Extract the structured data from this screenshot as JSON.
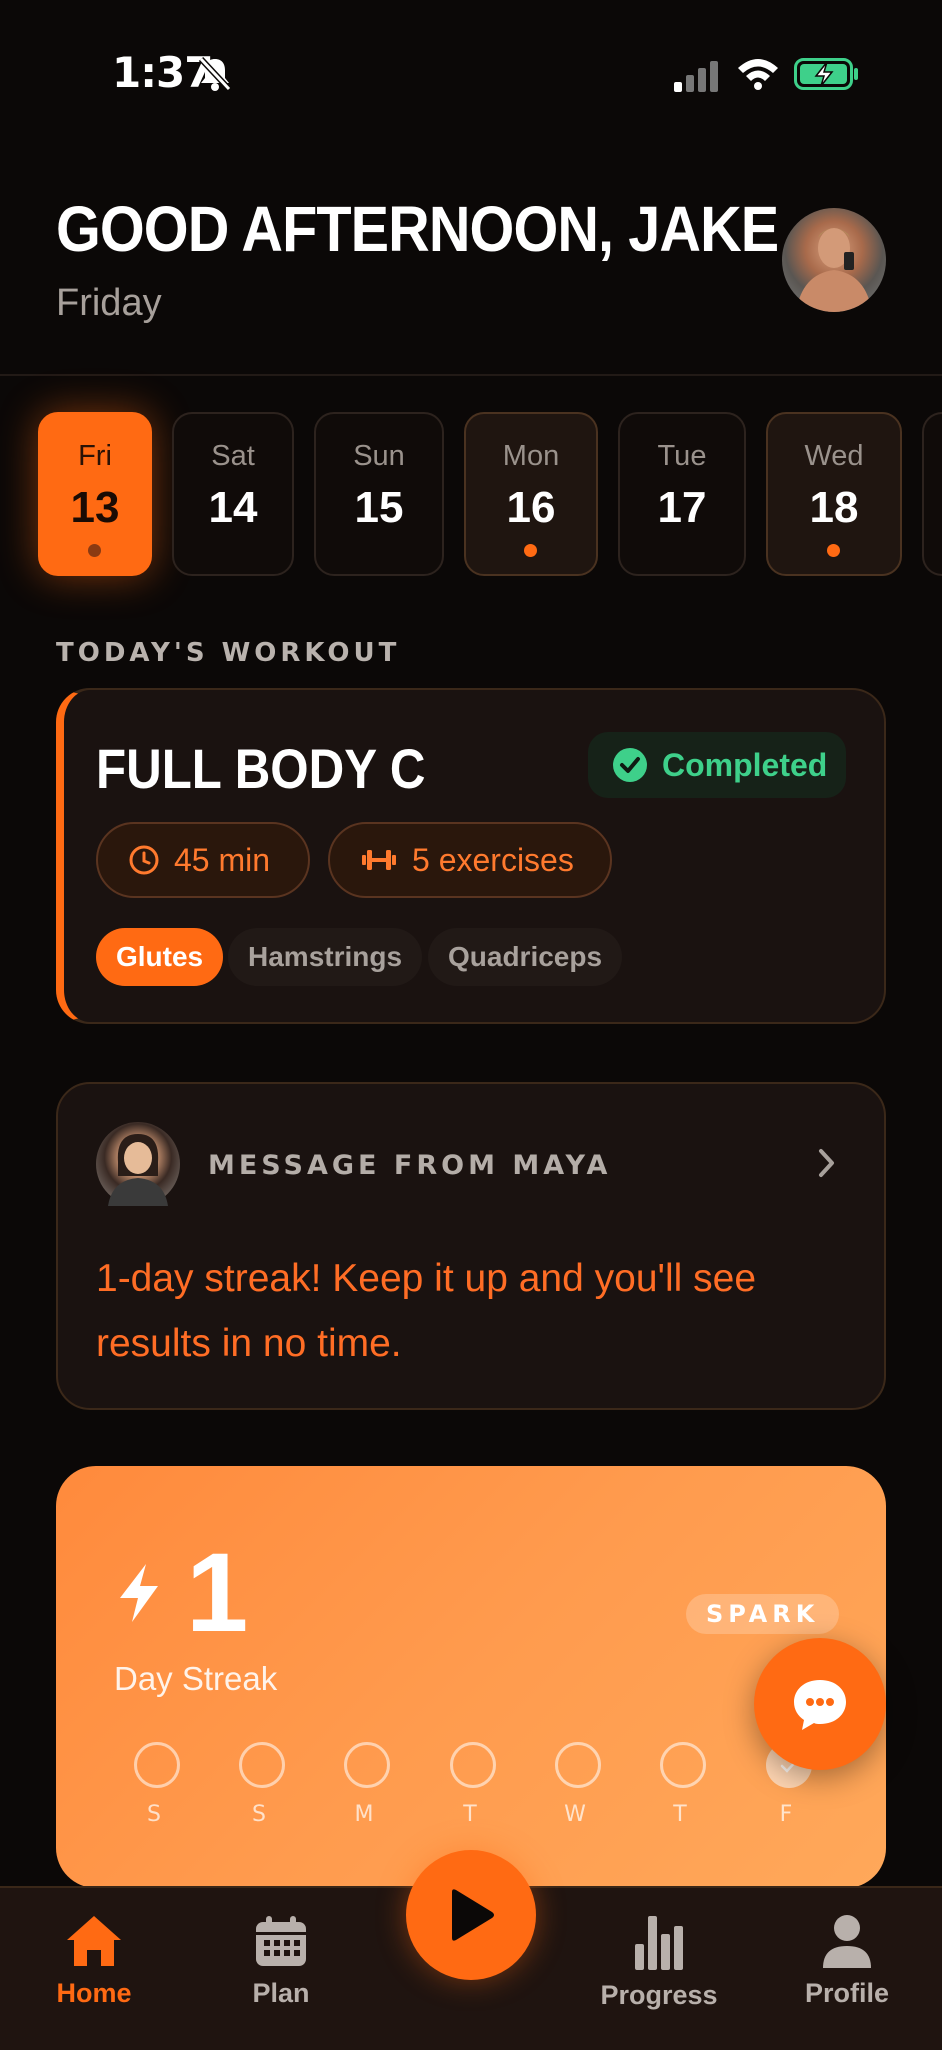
{
  "status_bar": {
    "time": "1:37"
  },
  "header": {
    "greeting": "GOOD AFTERNOON, JAKE",
    "day": "Friday"
  },
  "dates": [
    {
      "day": "Fri",
      "num": "13",
      "state": "selected"
    },
    {
      "day": "Sat",
      "num": "14",
      "state": "none"
    },
    {
      "day": "Sun",
      "num": "15",
      "state": "none"
    },
    {
      "day": "Mon",
      "num": "16",
      "state": "planned"
    },
    {
      "day": "Tue",
      "num": "17",
      "state": "none"
    },
    {
      "day": "Wed",
      "num": "18",
      "state": "planned"
    }
  ],
  "today_label": "TODAY'S WORKOUT",
  "workout": {
    "title": "FULL BODY C",
    "status": "Completed",
    "duration": "45 min",
    "exercises": "5 exercises",
    "tags": [
      "Glutes",
      "Hamstrings",
      "Quadriceps"
    ]
  },
  "message": {
    "label": "MESSAGE FROM MAYA",
    "text": "1-day streak! Keep it up and you'll see results in no time."
  },
  "streak": {
    "count": "1",
    "label": "Day Streak",
    "badge": "SPARK",
    "week": [
      "S",
      "S",
      "M",
      "T",
      "W",
      "T",
      "F"
    ],
    "done_index": 6
  },
  "tabs": {
    "home": "Home",
    "plan": "Plan",
    "progress": "Progress",
    "profile": "Profile"
  },
  "colors": {
    "accent": "#ff6a13",
    "success": "#3ed08a",
    "background": "#0b0807"
  }
}
